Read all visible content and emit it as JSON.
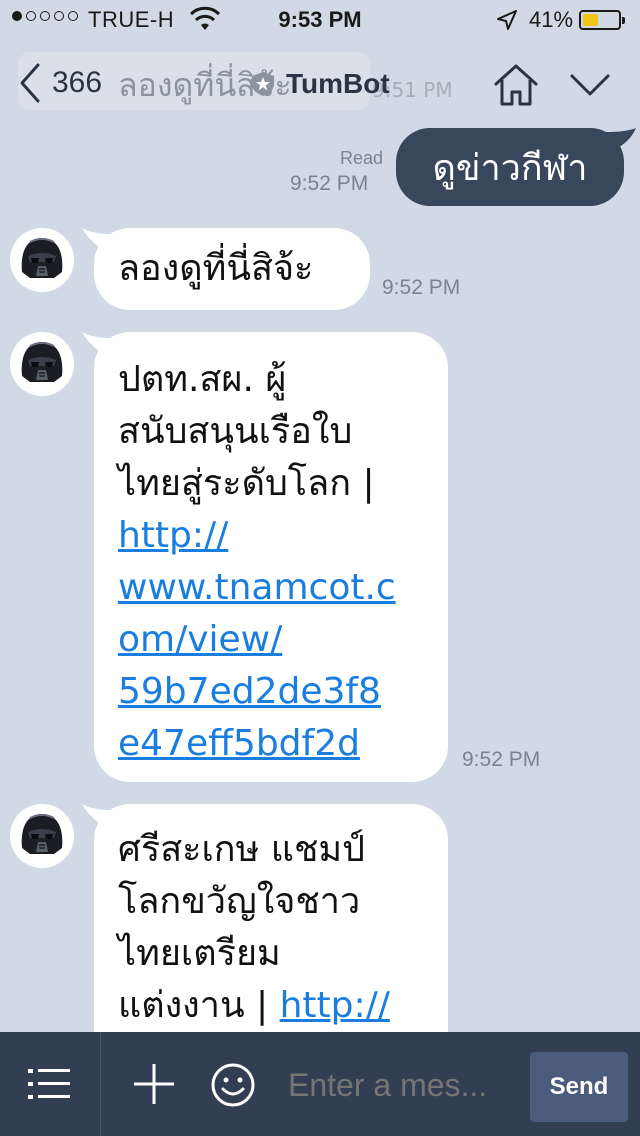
{
  "status_bar": {
    "carrier": "TRUE-H",
    "time": "9:53 PM",
    "battery_percent": "41%",
    "battery_level": 0.41,
    "signal_bars_filled": 1,
    "signal_bars_total": 5
  },
  "header": {
    "back_count": "366",
    "title": "TumBot",
    "ghost_preview_text": "ลองดูที่นี่สิจ้ะ",
    "ghost_preview_time": "9:51 PM",
    "icons": [
      "chevron-left-icon",
      "official-star-icon",
      "home-icon",
      "chevron-down-icon"
    ]
  },
  "messages": [
    {
      "direction": "out",
      "text": "ดูข่าวกีฬา",
      "read_label": "Read",
      "time": "9:52 PM"
    },
    {
      "direction": "in",
      "text": "ลองดูที่นี่สิจ้ะ",
      "time": "9:52 PM"
    },
    {
      "direction": "in",
      "lines": [
        "ปตท.สผ. ผู้",
        "สนับสนุนเรือใบ",
        "ไทยสู่ระดับโลก |"
      ],
      "link_lines": [
        "http://",
        "www.tnamcot.c",
        "om/view/",
        "59b7ed2de3f8",
        "e47eff5bdf2d"
      ],
      "time": "9:52 PM"
    },
    {
      "direction": "in",
      "lines": [
        "ศรีสะเกษ แชมป์",
        "โลกขวัญใจชาว",
        "ไทยเตรียม"
      ],
      "last_line_text": "แต่งงาน | ",
      "last_line_link": "http://"
    }
  ],
  "input_bar": {
    "placeholder": "Enter a mes...",
    "send_label": "Send"
  },
  "colors": {
    "background": "#d1d9e6",
    "outgoing_bubble": "#38475b",
    "incoming_bubble": "#ffffff",
    "link": "#1a7de0",
    "bottom_bar": "#323e52",
    "send_button": "#4a5b7c",
    "battery": "#f5c518"
  }
}
